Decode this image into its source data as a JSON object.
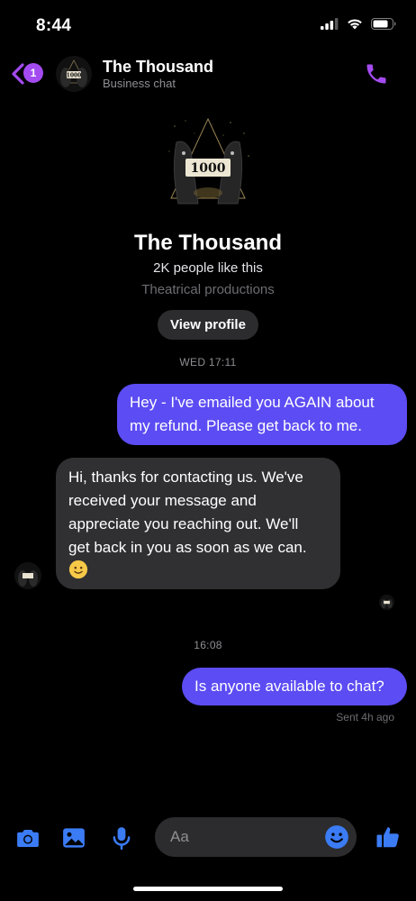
{
  "status_bar": {
    "time": "8:44"
  },
  "header": {
    "unread_count": "1",
    "title": "The Thousand",
    "subtitle": "Business chat",
    "logo_text": "1000"
  },
  "profile": {
    "logo_text": "1000",
    "name": "The Thousand",
    "likes": "2K people like this",
    "category": "Theatrical productions",
    "view_profile_label": "View profile"
  },
  "messages": [
    {
      "timestamp": "WED 17:11"
    },
    {
      "direction": "outgoing",
      "lines": [
        "Hey - I've emailed you AGAIN about",
        "my refund. Please get back to me."
      ]
    },
    {
      "direction": "incoming",
      "lines": [
        "Hi, thanks for contacting us. We've",
        "received your message and",
        "appreciate you reaching out. We'll",
        "get back in you as soon as we can."
      ],
      "emoji": "slightly-smiling-face"
    },
    {
      "timestamp": "16:08"
    },
    {
      "direction": "outgoing",
      "lines": [
        "Is anyone available to chat?"
      ],
      "status": "Sent 4h ago"
    }
  ],
  "composer": {
    "placeholder": "Aa"
  },
  "colors": {
    "accent_purple": "#a34bf0",
    "outgoing_bubble": "#5c4cf3",
    "incoming_bubble": "#303033",
    "composer_blue": "#3b7cf5"
  }
}
